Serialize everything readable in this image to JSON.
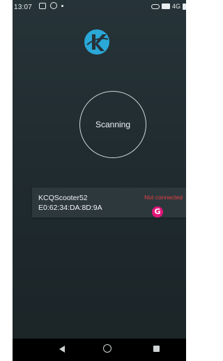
{
  "status_bar": {
    "time": "13:07",
    "network": "4G"
  },
  "scanner": {
    "label": "Scanning"
  },
  "device": {
    "name": "KCQScooter52",
    "mac": "E0:62:34:DA:8D:9A",
    "status": "Not connected",
    "status_color": "#e54040"
  },
  "badge": {
    "letter": "G",
    "color": "#e3157a"
  },
  "icons": {
    "logo": "app-logo-k-icon",
    "nav_back": "back-triangle-icon",
    "nav_home": "home-circle-icon",
    "nav_recent": "recent-square-icon"
  }
}
